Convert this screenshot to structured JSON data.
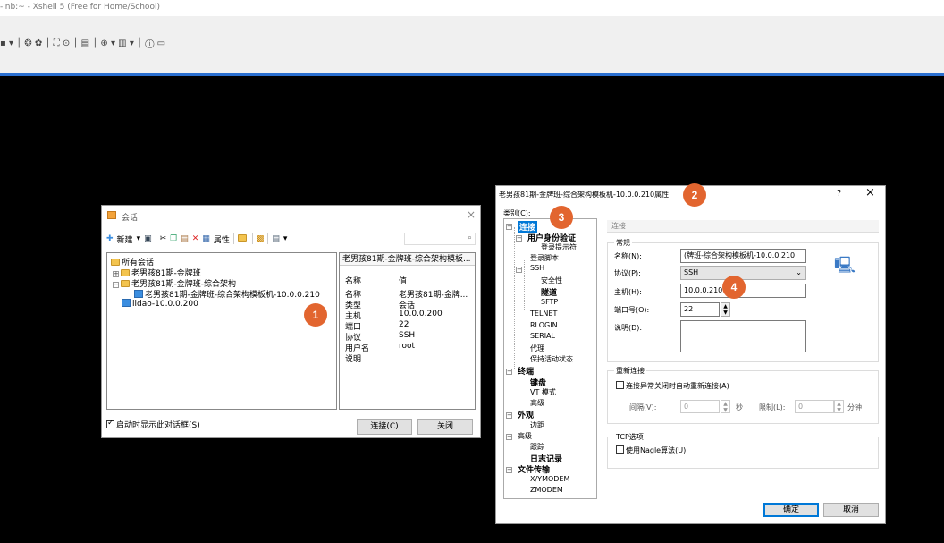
{
  "app": {
    "title": "-lnb:~ - Xshell 5 (Free for Home/School)",
    "toolbar_glyphs": "▪ ▾ │ ❂ ✿ │ ⛶ ⊙ │ ▤ │ ⊕ ▾ ▥ ▾ │ ⓘ ▭"
  },
  "session_dialog": {
    "title": "会话",
    "close": "×",
    "toolbar": {
      "new": "新建",
      "new_arrow": "▾",
      "properties": "属性",
      "dropdown": "▾"
    },
    "tree": {
      "root": "所有会话",
      "group1": "老男孩81期-金牌班",
      "group2": "老男孩81期-金牌班-综合架构",
      "selected_session": "老男孩81期-金牌班-综合架构模板机-10.0.0.210",
      "other_session": "lidao-10.0.0.200"
    },
    "detail_header": "老男孩81期-金牌班-综合架构模板...",
    "detail_col_name": "名称",
    "detail_col_value": "值",
    "details": [
      {
        "name": "名称",
        "value": "老男孩81期-金牌..."
      },
      {
        "name": "类型",
        "value": "会话"
      },
      {
        "name": "主机",
        "value": "10.0.0.200"
      },
      {
        "name": "端口",
        "value": "22"
      },
      {
        "name": "协议",
        "value": "SSH"
      },
      {
        "name": "用户名",
        "value": "root"
      },
      {
        "name": "说明",
        "value": ""
      }
    ],
    "startup_checkbox": "启动时显示此对话框(S)",
    "connect_button": "连接(C)",
    "close_button": "关闭"
  },
  "props_dialog": {
    "title": "老男孩81期-金牌班-综合架构模板机-10.0.0.210属性",
    "help": "?",
    "close": "×",
    "category_label": "类别(C):",
    "tree": {
      "connection": "连接",
      "user_auth": "用户身份验证",
      "login_prompt": "登录提示符",
      "login_script": "登录脚本",
      "ssh": "SSH",
      "security": "安全性",
      "tunnel": "隧道",
      "sftp": "SFTP",
      "telnet": "TELNET",
      "rlogin": "RLOGIN",
      "serial": "SERIAL",
      "proxy": "代理",
      "keepalive": "保持活动状态",
      "terminal": "终端",
      "keyboard": "键盘",
      "vt_mode": "VT 模式",
      "advanced_term": "高级",
      "appearance": "外观",
      "margin": "边距",
      "advanced": "高级",
      "trace": "跟踪",
      "log": "日志记录",
      "file_transfer": "文件传输",
      "xymodem": "X/YMODEM",
      "zmodem": "ZMODEM"
    },
    "panel_title": "连接",
    "general_group": "常规",
    "name_label": "名称(N):",
    "name_value": "(牌班-综合架构模板机-10.0.0.210",
    "protocol_label": "协议(P):",
    "protocol_value": "SSH",
    "host_label": "主机(H):",
    "host_value": "10.0.0.210",
    "port_label": "端口号(O):",
    "port_value": "22",
    "desc_label": "说明(D):",
    "reconnect_group": "重新连接",
    "reconnect_checkbox": "连接异常关闭时自动重新连接(A)",
    "interval_label": "间隔(V):",
    "interval_value": "0",
    "interval_unit": "秒",
    "limit_label": "限制(L):",
    "limit_value": "0",
    "limit_unit": "分钟",
    "tcp_group": "TCP选项",
    "nagle_checkbox": "使用Nagle算法(U)",
    "ok_button": "确定",
    "cancel_button": "取消"
  },
  "annotations": {
    "b1": "1",
    "b2": "2",
    "b3": "3",
    "b4": "4"
  },
  "colors": {
    "badge": "#e2652f",
    "accent": "#2a6fd0",
    "selection": "#0078d7"
  }
}
